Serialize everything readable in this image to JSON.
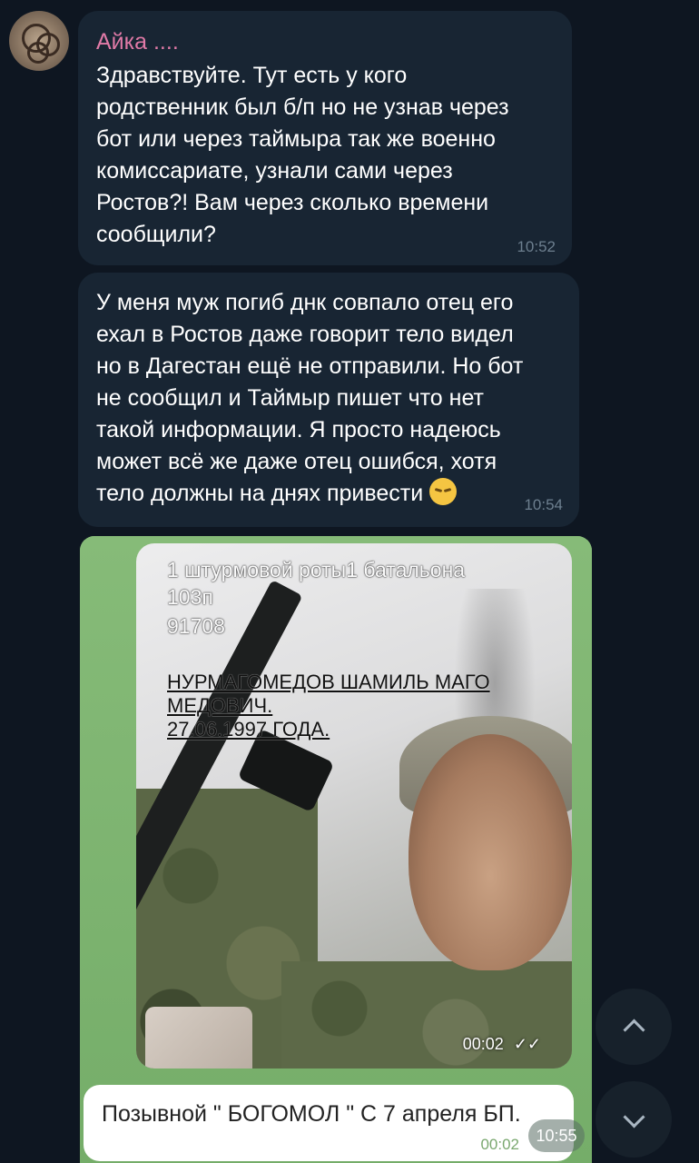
{
  "messages": [
    {
      "sender": "Айка ....",
      "text": "Здравствуйте. Тут есть у кого\nродственник был б/п но не узнав через\nбот или через таймыра так же военно\nкомиссариате, узнали сами через\nРостов?! Вам через сколько времени\nсообщили?",
      "time": "10:52"
    },
    {
      "text": "У меня муж погиб днк совпало отец его\nехал в Ростов даже говорит тело видел\nно в Дагестан ещё не отправили. Но бот\nне сообщил и Таймыр пишет что нет\nтакой информации. Я просто надеюсь\nможет всё же даже отец ошибся, хотя\nтело должны на днях привести",
      "emoji": "pensive-face",
      "time": "10:54"
    }
  ],
  "post": {
    "overlay_lines": [
      "1 штурмовой роты1 батальона",
      "103п",
      "91708",
      "НУРМАГОМЕДОВ ШАМИЛЬ МАГО",
      "МЕДОВИЧ.",
      "27.06.1997 ГОДА."
    ],
    "video_time": "00:02",
    "caption": "Позывной \" БОГОМОЛ \" С 7 апреля БП.",
    "caption_time": "00:02",
    "time_badge": "10:55"
  },
  "controls": {
    "scroll_up_icon": "chevron-up-icon",
    "scroll_down_icon": "chevron-down-icon"
  },
  "colors": {
    "background": "#0e1621",
    "bubble": "#182533",
    "sender_name": "#e07aa7",
    "post_background": "#7bb26e"
  }
}
